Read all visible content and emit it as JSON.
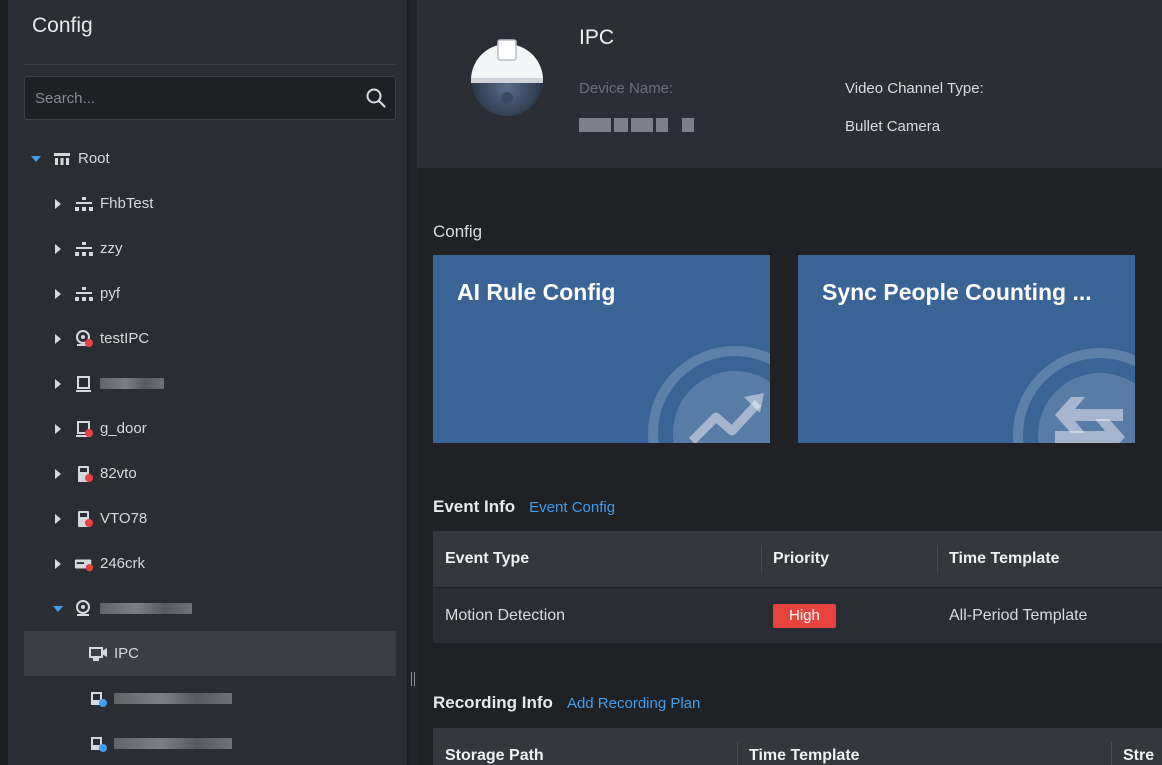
{
  "sidebar": {
    "title": "Config",
    "search_placeholder": "Search...",
    "tree": {
      "root": "Root",
      "fhbtest": "FhbTest",
      "zzy": "zzy",
      "pyf": "pyf",
      "testipc": "testIPC",
      "g_door": "g_door",
      "vto82": "82vto",
      "vto78": "VTO78",
      "crk246": "246crk",
      "ipc": "IPC"
    }
  },
  "header": {
    "name": "IPC",
    "device_name_label": "Device Name:",
    "video_channel_type_label": "Video Channel Type:",
    "video_channel_type_value": "Bullet Camera"
  },
  "config": {
    "heading": "Config",
    "cards": [
      {
        "title": "AI Rule Config"
      },
      {
        "title": "Sync People Counting ..."
      }
    ]
  },
  "event_info": {
    "label": "Event Info",
    "link": "Event Config",
    "columns": [
      "Event Type",
      "Priority",
      "Time Template"
    ],
    "rows": [
      {
        "event_type": "Motion Detection",
        "priority": "High",
        "time_template": "All-Period Template"
      }
    ]
  },
  "recording_info": {
    "label": "Recording Info",
    "link": "Add Recording Plan",
    "columns": [
      "Storage Path",
      "Time Template",
      "Stre"
    ]
  },
  "colors": {
    "accent": "#3e9ef0",
    "card": "#3a6496",
    "priority_high": "#e8433e"
  }
}
